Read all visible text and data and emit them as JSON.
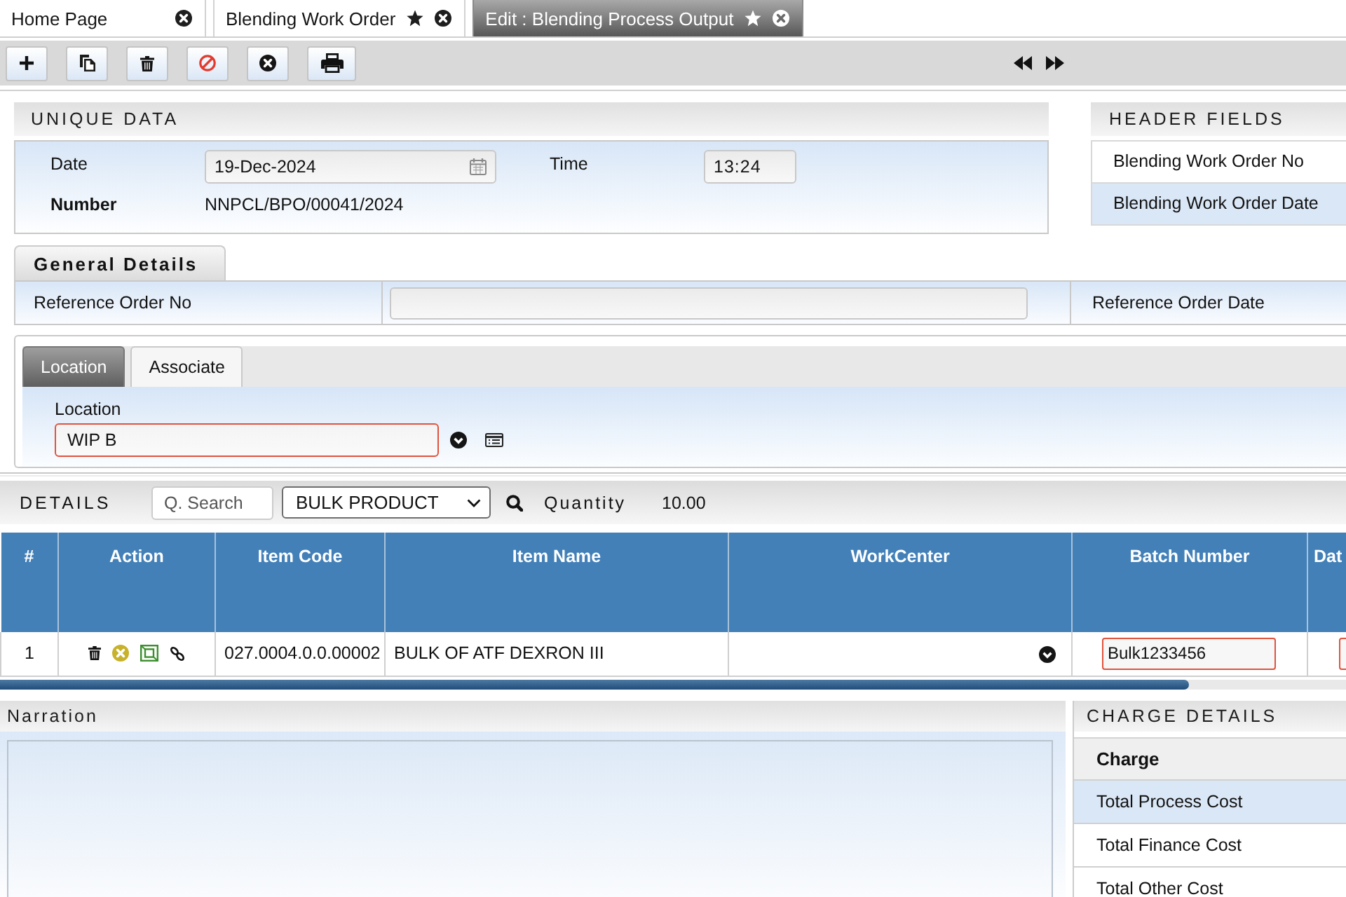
{
  "tabs": [
    {
      "label": "Home Page",
      "selected": false,
      "starred": false
    },
    {
      "label": "Blending Work Order",
      "selected": false,
      "starred": true
    },
    {
      "label": "Edit : Blending Process Output",
      "selected": true,
      "starred": true
    }
  ],
  "unique_data": {
    "title": "UNIQUE DATA",
    "date": {
      "label": "Date",
      "value": "19-Dec-2024"
    },
    "time": {
      "label": "Time",
      "value": "13:24"
    },
    "number": {
      "label": "Number",
      "value": "NNPCL/BPO/00041/2024"
    }
  },
  "header_fields": {
    "title": "HEADER FIELDS",
    "items": [
      {
        "label": "Blending Work Order No",
        "selected": false
      },
      {
        "label": "Blending Work Order Date",
        "selected": true
      }
    ]
  },
  "general_details": {
    "tab": "General Details",
    "reference_order_no": {
      "label": "Reference Order No"
    },
    "reference_order_date": {
      "label": "Reference Order Date"
    }
  },
  "location_panel": {
    "tabs": [
      {
        "label": "Location",
        "selected": true
      },
      {
        "label": "Associate",
        "selected": false
      }
    ],
    "location": {
      "label": "Location",
      "value": "WIP B",
      "required": true
    }
  },
  "details": {
    "title": "DETAILS",
    "search": {
      "placeholder": "Q. Search"
    },
    "filter": {
      "value": "BULK PRODUCT"
    },
    "quantity": {
      "label": "Quantity",
      "value": "10.00"
    }
  },
  "table": {
    "columns": [
      "#",
      "Action",
      "Item Code",
      "Item Name",
      "WorkCenter",
      "Batch Number",
      "Dat"
    ],
    "rows": [
      {
        "number": "1",
        "item_code": "027.0004.0.0.00002",
        "item_name": "BULK OF ATF DEXRON III",
        "batch_number": {
          "value": "Bulk1233456",
          "required": true
        },
        "column_7": {
          "required": true
        }
      }
    ]
  },
  "narration": {
    "title": "Narration"
  },
  "charge_details": {
    "title": "CHARGE DETAILS",
    "header": "Charge",
    "rows": [
      {
        "label": "Total Process Cost",
        "selected": true
      },
      {
        "label": "Total Finance Cost",
        "selected": false
      },
      {
        "label": "Total Other Cost",
        "selected": false
      }
    ]
  }
}
